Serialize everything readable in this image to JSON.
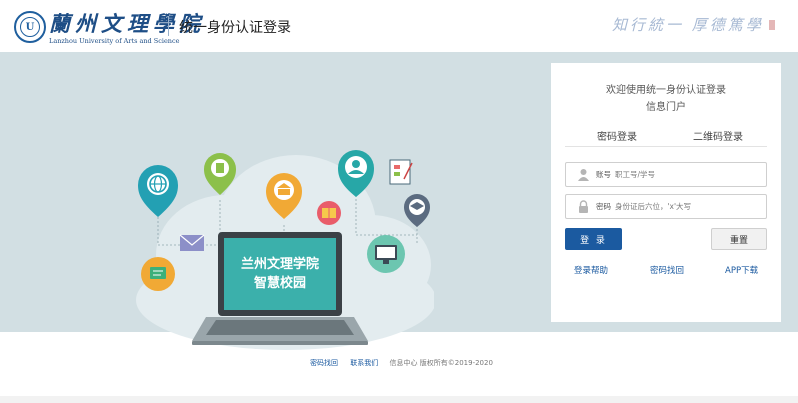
{
  "header": {
    "logo_chinese": "蘭州文理學院",
    "logo_english": "Lanzhou University of Arts and Science",
    "system_name": "统一身份认证登录",
    "motto": "知行統一 厚德篤學"
  },
  "banner": {
    "screen_line1": "兰州文理学院",
    "screen_line2": "智慧校园"
  },
  "login": {
    "welcome": "欢迎使用统一身份认证登录",
    "portal": "信息门户",
    "tabs": [
      "密码登录",
      "二维码登录"
    ],
    "account_label": "账号",
    "account_placeholder": "职工号/学号",
    "password_label": "密码",
    "password_placeholder": "身份证后六位，'x'大写",
    "login_button": "登 录",
    "reset_button": "重置",
    "links": {
      "help": "登录帮助",
      "recover": "密码找回",
      "app": "APP下载"
    }
  },
  "footer": {
    "link_recover": "密码找回",
    "link_contact": "联系我们",
    "copyright": "信息中心 版权所有©2019-2020"
  },
  "colors": {
    "brand_blue": "#1b5aa0",
    "banner_bg": "#d2dfe3",
    "screen_teal": "#3bb0ab"
  }
}
